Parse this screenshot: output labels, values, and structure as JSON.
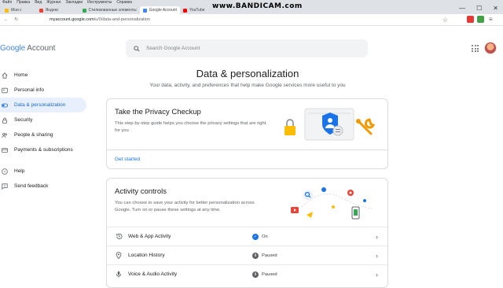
{
  "browser": {
    "menu": [
      "Файл",
      "Правка",
      "Вид",
      "Журнал",
      "Закладки",
      "Инструменты",
      "Справка"
    ],
    "tabs": [
      {
        "label": "Мои с",
        "color": "#fbbc05"
      },
      {
        "label": "Яндекс",
        "color": "#ea4335"
      },
      {
        "label": "Стилизованные элементы",
        "color": "#34a853"
      },
      {
        "label": "Google Account",
        "color": "#4285f4"
      },
      {
        "label": "YouTube",
        "color": "#ff0000"
      }
    ],
    "recorder_watermark": "www.BANDICAM.com",
    "url_host": "myaccount.google.com",
    "url_path": "/u/0/data-and-personalization"
  },
  "header": {
    "logo_text": "Google",
    "logo_suffix": "Account",
    "search_placeholder": "Search Google Account"
  },
  "sidebar": {
    "items": [
      {
        "label": "Home",
        "icon": "home-icon",
        "active": false
      },
      {
        "label": "Personal info",
        "icon": "person-icon",
        "active": false
      },
      {
        "label": "Data & personalization",
        "icon": "toggle-icon",
        "active": true
      },
      {
        "label": "Security",
        "icon": "lock-icon",
        "active": false
      },
      {
        "label": "People & sharing",
        "icon": "people-icon",
        "active": false
      },
      {
        "label": "Payments & subscriptions",
        "icon": "card-icon",
        "active": false
      }
    ],
    "footer_items": [
      {
        "label": "Help",
        "icon": "help-icon"
      },
      {
        "label": "Send feedback",
        "icon": "feedback-icon"
      }
    ]
  },
  "main": {
    "title": "Data & personalization",
    "subtitle": "Your data, activity, and preferences that help make Google services more useful to you",
    "privacy_card": {
      "title": "Take the Privacy Checkup",
      "description": "This step-by-step guide helps you choose the privacy settings that are right for you",
      "cta": "Get started"
    },
    "activity_card": {
      "title": "Activity controls",
      "description": "You can choose to save your activity for better personalization across Google. Turn on or pause these settings at any time.",
      "rows": [
        {
          "label": "Web & App Activity",
          "icon": "history-icon",
          "status": "On",
          "status_color": "#1a73e8",
          "status_mark": "✓"
        },
        {
          "label": "Location History",
          "icon": "location-pin-icon",
          "status": "Paused",
          "status_color": "#5f6368",
          "status_mark": "Ⅱ"
        },
        {
          "label": "Voice & Audio Activity",
          "icon": "microphone-icon",
          "status": "Paused",
          "status_color": "#5f6368",
          "status_mark": "Ⅱ"
        }
      ]
    }
  },
  "colors": {
    "accent": "#1a73e8",
    "active_nav_bg": "#e8f0fe",
    "active_nav_text": "#1967d2"
  }
}
